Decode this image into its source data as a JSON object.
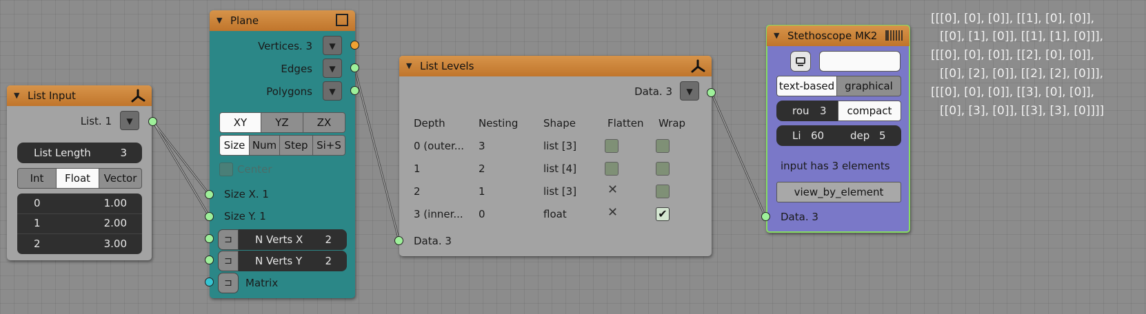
{
  "list_input": {
    "title": "List Input",
    "output_label": "List. 1",
    "list_length_label": "List Length",
    "list_length_value": "3",
    "type_buttons": [
      "Int",
      "Float",
      "Vector"
    ],
    "active_type": "Float",
    "items": [
      {
        "index": "0",
        "value": "1.00"
      },
      {
        "index": "1",
        "value": "2.00"
      },
      {
        "index": "2",
        "value": "3.00"
      }
    ]
  },
  "plane": {
    "title": "Plane",
    "outputs": [
      "Vertices. 3",
      "Edges",
      "Polygons"
    ],
    "plane_buttons": [
      "XY",
      "YZ",
      "ZX"
    ],
    "active_plane": "XY",
    "mode_buttons": [
      "Size",
      "Num",
      "Step",
      "Si+S"
    ],
    "active_mode": "Size",
    "center_label": "Center",
    "inputs": {
      "size_x": "Size X. 1",
      "size_y": "Size Y. 1",
      "n_verts_x_label": "N Verts X",
      "n_verts_x_value": "2",
      "n_verts_y_label": "N Verts Y",
      "n_verts_y_value": "2",
      "matrix_label": "Matrix"
    }
  },
  "list_levels": {
    "title": "List Levels",
    "output_label": "Data. 3",
    "input_label": "Data. 3",
    "headers": [
      "Depth",
      "Nesting",
      "Shape",
      "Flatten",
      "Wrap"
    ],
    "rows": [
      {
        "depth": "0 (outer...",
        "nesting": "3",
        "shape": "list [3]",
        "flatten": "checkbox",
        "wrap": "checkbox"
      },
      {
        "depth": "1",
        "nesting": "2",
        "shape": "list [4]",
        "flatten": "checkbox",
        "wrap": "checkbox"
      },
      {
        "depth": "2",
        "nesting": "1",
        "shape": "list [3]",
        "flatten": "x",
        "wrap": "checkbox"
      },
      {
        "depth": "3 (inner...",
        "nesting": "0",
        "shape": "float",
        "flatten": "x",
        "wrap": "checked"
      }
    ]
  },
  "stethoscope": {
    "title": "Stethoscope MK2",
    "text_field": "",
    "mode_buttons": [
      "text-based",
      "graphical"
    ],
    "active_mode": "text-based",
    "rounding_label": "rou",
    "rounding_value": "3",
    "compact_label": "compact",
    "lines_label": "Li",
    "lines_value": "60",
    "depth_label": "dep",
    "depth_value": "5",
    "info_text": "input has 3 elements",
    "view_button": "view_by_element",
    "input_label": "Data. 3"
  },
  "output_text": [
    "[[[0], [0], [0]], [[1], [0], [0]],",
    "[[0], [1], [0]], [[1], [1], [0]]],",
    "[[[0], [0], [0]], [[2], [0], [0]],",
    "[[0], [2], [0]], [[2], [2], [0]]],",
    "[[[0], [0], [0]], [[3], [0], [0]],",
    "[[0], [3], [0]], [[3], [3], [0]]]]"
  ],
  "colors": {
    "background": "#8c8c8c",
    "header_orange": "#c98436",
    "plane_body": "#2b8787",
    "stethoscope_body": "#7a78c8",
    "socket_green": "#9ef09a",
    "socket_orange": "#f0a232",
    "socket_blue": "#36c4d2"
  }
}
